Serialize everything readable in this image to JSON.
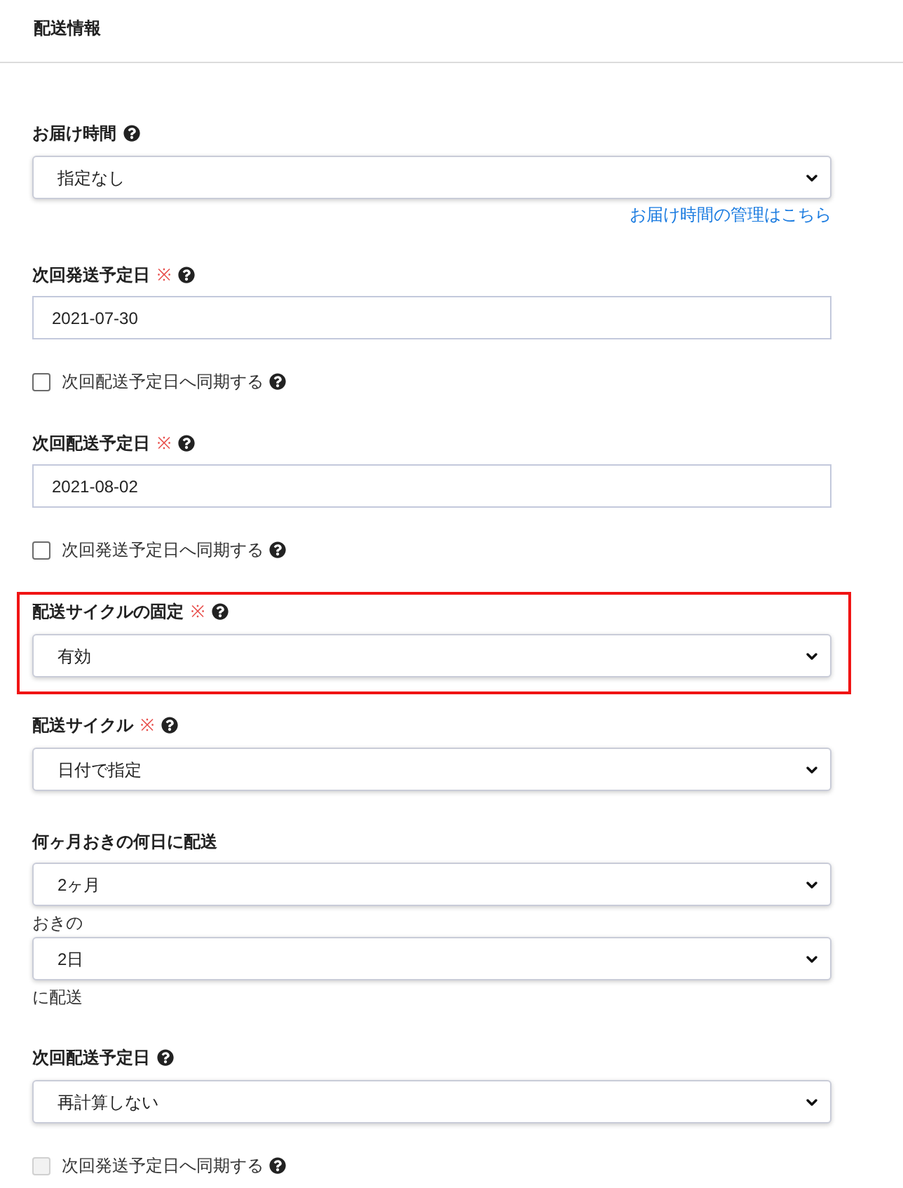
{
  "section": {
    "title": "配送情報"
  },
  "fields": [
    {
      "kind": "select",
      "label": "お届け時間",
      "help": true,
      "value": "指定なし",
      "link": "お届け時間の管理はこちら",
      "highlighted": false
    },
    {
      "kind": "text",
      "label": "次回発送予定日",
      "required_mark": "※",
      "help": true,
      "value": "2021-07-30",
      "highlighted": false
    },
    {
      "kind": "checkbox",
      "label": "次回配送予定日へ同期する",
      "help": true,
      "checked": false,
      "disabled": false,
      "highlighted": false
    },
    {
      "kind": "text",
      "label": "次回配送予定日",
      "required_mark": "※",
      "help": true,
      "value": "2021-08-02",
      "highlighted": false
    },
    {
      "kind": "checkbox",
      "label": "次回発送予定日へ同期する",
      "help": true,
      "checked": false,
      "disabled": false,
      "highlighted": false
    },
    {
      "kind": "select",
      "label": "配送サイクルの固定",
      "required_mark": "※",
      "help": true,
      "value": "有効",
      "highlighted": true
    },
    {
      "kind": "select",
      "label": "配送サイクル",
      "required_mark": "※",
      "help": true,
      "value": "日付で指定",
      "highlighted": false
    },
    {
      "kind": "group",
      "label": "何ヶ月おきの何日に配送",
      "help": false,
      "highlighted": false,
      "parts": [
        {
          "kind": "select",
          "value": "2ヶ月"
        },
        {
          "kind": "note",
          "text": "おきの"
        },
        {
          "kind": "select",
          "value": "2日"
        },
        {
          "kind": "note",
          "text": "に配送"
        }
      ]
    },
    {
      "kind": "select",
      "label": "次回配送予定日",
      "help": true,
      "value": "再計算しない",
      "highlighted": false
    },
    {
      "kind": "checkbox",
      "label": "次回発送予定日へ同期する",
      "help": true,
      "checked": false,
      "disabled": true,
      "highlighted": false
    }
  ]
}
